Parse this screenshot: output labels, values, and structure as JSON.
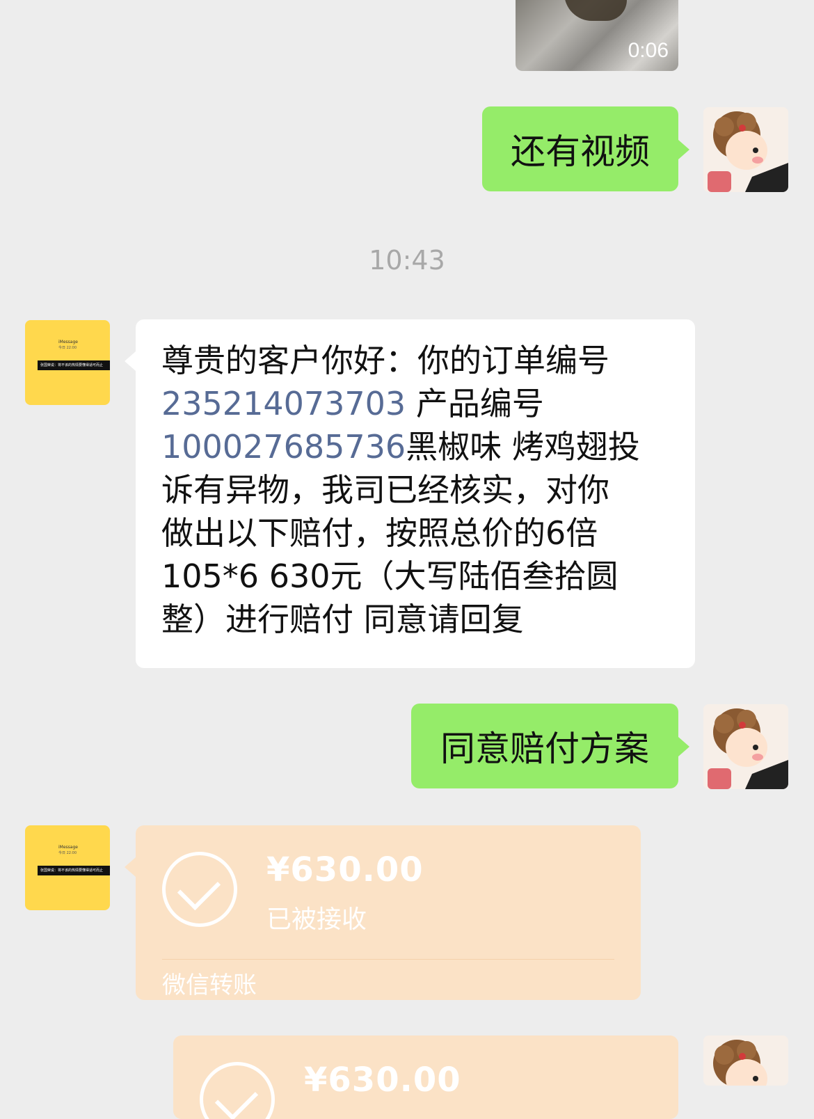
{
  "video_message": {
    "duration": "0:06"
  },
  "messages": {
    "m1": {
      "text": "还有视频"
    },
    "timestamp": "10:43",
    "m2": {
      "line1": "尊贵的客户你好：你的订单编号",
      "order_no": "235214073703",
      "line2_suffix": " 产品编号",
      "product_no": "100027685736",
      "line3_suffix": "黑椒味 烤鸡翅投",
      "line4": "诉有异物，我司已经核实，对你",
      "line5": "做出以下赔付，按照总价的6倍",
      "line6": "105*6 630元（大写陆佰叁拾圆",
      "line7": "整）进行赔付 同意请回复"
    },
    "m3": {
      "text": "同意赔付方案"
    },
    "transfer1": {
      "amount": "¥630.00",
      "status": "已被接收",
      "source": "微信转账"
    },
    "transfer2": {
      "amount": "¥630.00"
    }
  },
  "other_avatar": {
    "title": "iMessage",
    "line": "今日 22:00",
    "banner": "张国荣说：将不该的热情要懂得适可而止"
  },
  "colors": {
    "background": "#ededed",
    "my_bubble": "#95ec69",
    "transfer_bubble": "#fbe2c6",
    "link_number": "#576b95"
  }
}
